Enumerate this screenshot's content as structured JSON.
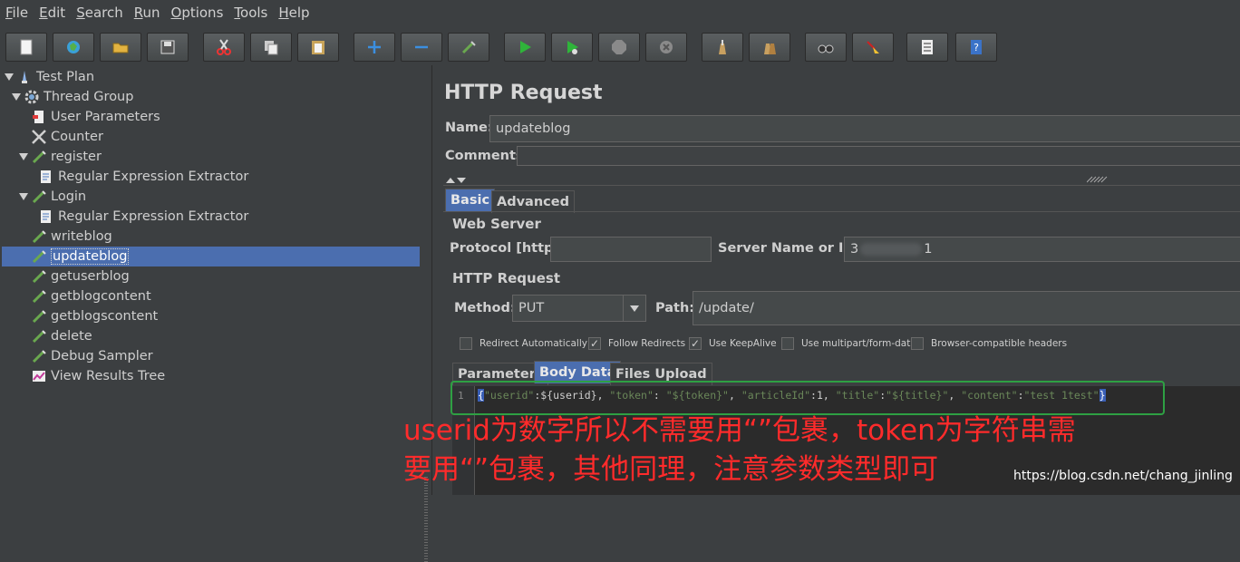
{
  "menu": [
    {
      "underline": "F",
      "rest": "ile"
    },
    {
      "underline": "E",
      "rest": "dit"
    },
    {
      "underline": "S",
      "rest": "earch"
    },
    {
      "underline": "R",
      "rest": "un"
    },
    {
      "underline": "O",
      "rest": "ptions"
    },
    {
      "underline": "T",
      "rest": "ools"
    },
    {
      "underline": "H",
      "rest": "elp"
    }
  ],
  "toolbar": [
    "new-icon",
    "templates-icon",
    "open-icon",
    "save-icon",
    "cut-icon",
    "copy-icon",
    "paste-icon",
    "expand-icon",
    "collapse-icon",
    "toggle-icon",
    "start-icon",
    "start-no-pause-icon",
    "stop-icon",
    "shutdown-icon",
    "clear-icon",
    "clear-all-icon",
    "search-icon",
    "reset-search-icon",
    "function-helper-icon",
    "help-icon"
  ],
  "tree": {
    "test_plan": "Test Plan",
    "thread_group": "Thread Group",
    "user_parameters": "User Parameters",
    "counter": "Counter",
    "register": "register",
    "regex1": "Regular Expression Extractor",
    "login": "Login",
    "regex2": "Regular Expression Extractor",
    "writeblog": "writeblog",
    "updateblog": "updateblog",
    "getuserblog": "getuserblog",
    "getblogcontent": "getblogcontent",
    "getblogscontent": "getblogscontent",
    "delete": "delete",
    "debug_sampler": "Debug Sampler",
    "view_results_tree": "View Results Tree"
  },
  "panel": {
    "title": "HTTP Request",
    "name_label": "Name:",
    "name_value": "updateblog",
    "comments_label": "Comments:",
    "tabs": [
      "Basic",
      "Advanced"
    ],
    "web_server": "Web Server",
    "protocol_label": "Protocol [http]:",
    "server_label": "Server Name or IP:",
    "server_value_start": "3",
    "server_value_end": "1",
    "http_request": "HTTP Request",
    "method_label": "Method:",
    "method_value": "PUT",
    "path_label": "Path:",
    "path_value": "/update/",
    "checkboxes": [
      {
        "label": "Redirect Automatically",
        "checked": false
      },
      {
        "label": "Follow Redirects",
        "checked": true
      },
      {
        "label": "Use KeepAlive",
        "checked": true
      },
      {
        "label": "Use multipart/form-data",
        "checked": false
      },
      {
        "label": "Browser-compatible headers",
        "checked": false
      }
    ],
    "body_tabs": [
      "Parameters",
      "Body Data",
      "Files Upload"
    ],
    "line_number": "1",
    "code": {
      "open": "{",
      "k1": "\"userid\"",
      "v1": ":${userid}, ",
      "k2": "\"token\"",
      "s1": ": ",
      "v2": "\"${token}\"",
      "s2": ", ",
      "k3": "\"articleId\"",
      "v3": ":1, ",
      "k4": "\"title\"",
      "s3": ":",
      "v4": "\"${title}\"",
      "s4": ", ",
      "k5": "\"content\"",
      "s5": ":",
      "v5": "\"test 1test\"",
      "close": "}"
    }
  },
  "annotation": {
    "line1": "userid为数字所以不需要用“”包裹，token为字符串需",
    "line2": "要用“”包裹，其他同理，注意参数类型即可"
  },
  "watermark": "https://blog.csdn.net/chang_jinling",
  "colors": {
    "selection": "#4b6eaf",
    "annotation": "#ff2b2b",
    "highlight_box": "#2ea043"
  }
}
